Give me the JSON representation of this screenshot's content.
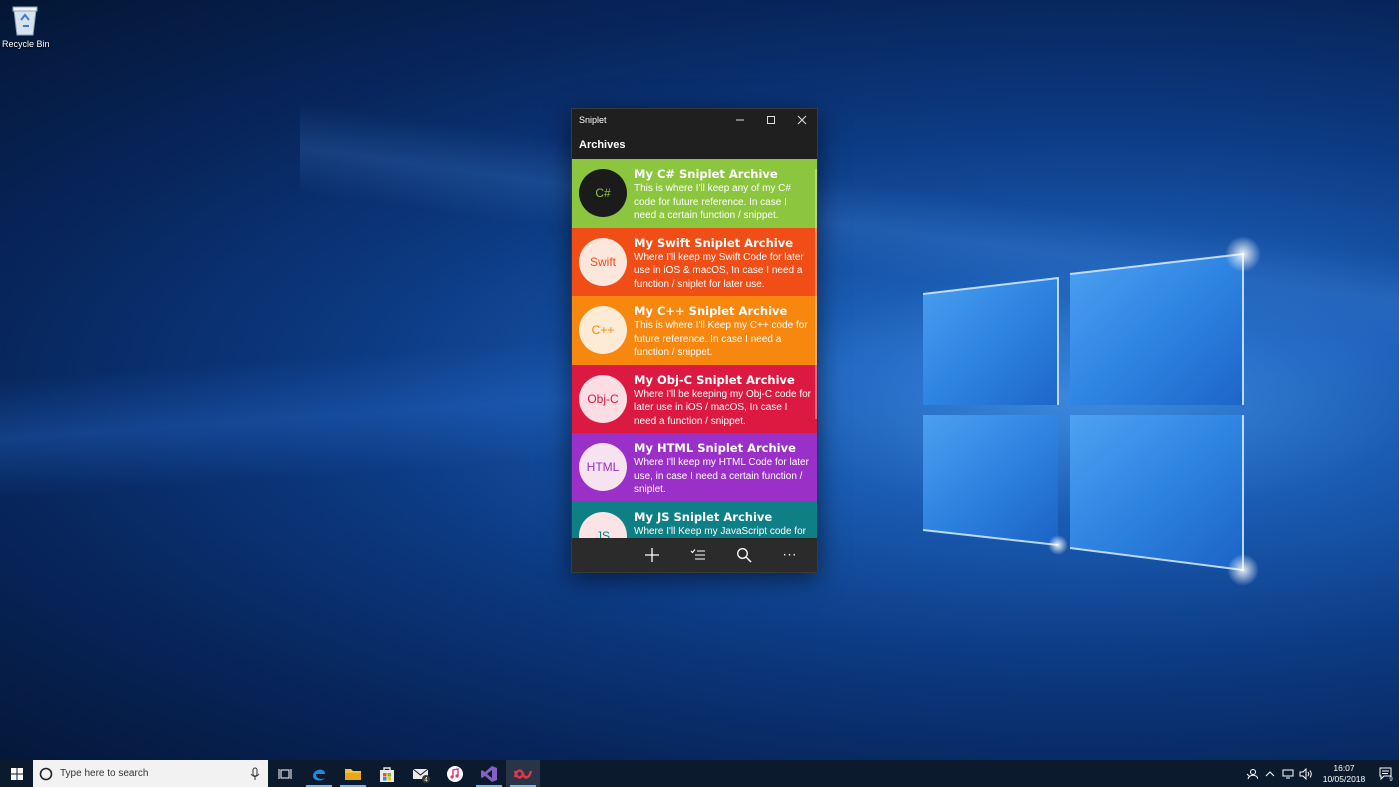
{
  "desktop": {
    "icons": [
      {
        "label": "Recycle Bin",
        "icon": "recycle-bin-icon"
      }
    ]
  },
  "window": {
    "title": "Sniplet",
    "controls": {
      "minimize": "minimize-icon",
      "maximize": "maximize-icon",
      "close": "close-icon"
    },
    "header": "Archives",
    "archives": [
      {
        "avatar": "C#",
        "title": "My C# Sniplet Archive",
        "description": "This is where I'll keep any of my C# code for future reference. In case I need a certain function / snippet.",
        "color": "#8cc63e",
        "avatar_bg": "#1b1b1b",
        "avatar_fg": "#8cc63e"
      },
      {
        "avatar": "Swift",
        "title": "My Swift Sniplet Archive",
        "description": "Where I'll keep my Swift Code for later use in iOS & macOS, In case I need a function / sniplet for later use.",
        "color": "#f04e16",
        "avatar_bg": "#fde6dc",
        "avatar_fg": "#f04e16"
      },
      {
        "avatar": "C++",
        "title": "My C++ Sniplet Archive",
        "description": "This is where I'll Keep my C++ code for future reference. In case I need a function / snippet.",
        "color": "#f7870e",
        "avatar_bg": "#fdebd5",
        "avatar_fg": "#f7870e"
      },
      {
        "avatar": "Obj-C",
        "title": "My Obj-C Sniplet Archive",
        "description": "Where I'll be keeping my Obj-C code for later use in iOS / macOS, In case I need a function / snippet.",
        "color": "#dc1a41",
        "avatar_bg": "#fbdde3",
        "avatar_fg": "#dc1a41"
      },
      {
        "avatar": "HTML",
        "title": "My HTML Sniplet Archive",
        "description": "Where I'll keep my HTML Code for later use, in case I need a certain function / sniplet.",
        "color": "#9b30c8",
        "avatar_bg": "#f6e3ef",
        "avatar_fg": "#9b30c8"
      },
      {
        "avatar": "JS",
        "title": "My JS Sniplet Archive",
        "description": "Where I'll Keep my JavaScript code for later use.",
        "color": "#0f7f86",
        "avatar_bg": "#fbe3e6",
        "avatar_fg": "#0f7f86"
      }
    ],
    "commands": [
      {
        "name": "add-button",
        "icon": "plus-icon"
      },
      {
        "name": "select-button",
        "icon": "checklist-icon"
      },
      {
        "name": "search-button",
        "icon": "search-icon"
      },
      {
        "name": "more-button",
        "icon": "more-icon",
        "glyph": "···"
      }
    ]
  },
  "taskbar": {
    "search_placeholder": "Type here to search",
    "apps": [
      {
        "name": "task-view",
        "icon": "task-view-icon"
      },
      {
        "name": "edge",
        "icon": "edge-icon",
        "running": true
      },
      {
        "name": "file-explorer",
        "icon": "folder-icon",
        "running": true
      },
      {
        "name": "store",
        "icon": "store-icon"
      },
      {
        "name": "mail",
        "icon": "mail-icon",
        "badge": "4"
      },
      {
        "name": "itunes",
        "icon": "itunes-icon"
      },
      {
        "name": "visual-studio",
        "icon": "visual-studio-icon",
        "running": true
      },
      {
        "name": "sniplet",
        "icon": "sniplet-icon",
        "running": true,
        "active": true
      }
    ],
    "clock": {
      "time": "16:07",
      "date": "10/05/2018"
    },
    "notification_badge": "9",
    "colors": {
      "background": "#0c1a2e",
      "accent": "#76b9ed"
    }
  }
}
